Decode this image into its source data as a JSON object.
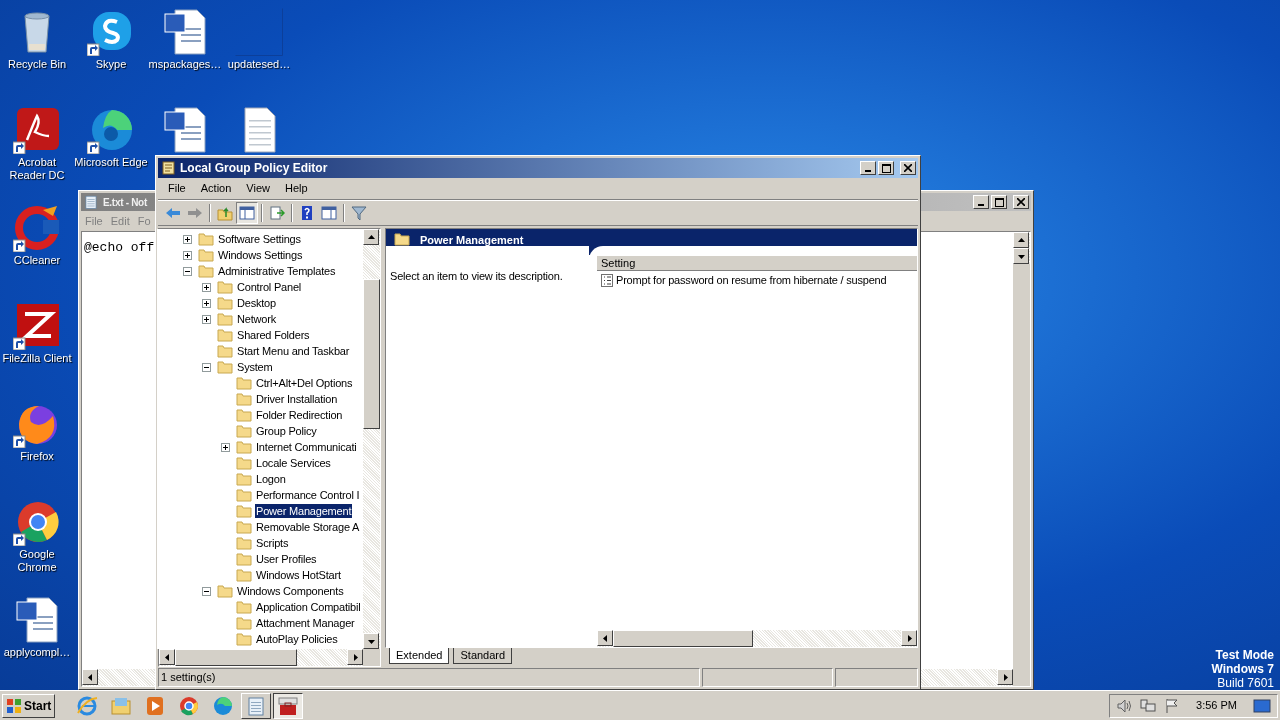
{
  "desktop_icons": [
    {
      "label": "Recycle Bin",
      "kind": "recycle-bin",
      "shortcut": false
    },
    {
      "label": "Skype",
      "kind": "skype",
      "shortcut": true
    },
    {
      "label": "mspackages…",
      "kind": "word",
      "shortcut": false
    },
    {
      "label": "updatesed…",
      "kind": "blank",
      "shortcut": false
    },
    {
      "label": "Acrobat Reader DC",
      "kind": "acrobat",
      "shortcut": true
    },
    {
      "label": "Microsoft Edge",
      "kind": "edge",
      "shortcut": true
    },
    {
      "kind": "word",
      "shortcut": false
    },
    {
      "kind": "text",
      "shortcut": false
    },
    {
      "label": "CCleaner",
      "kind": "ccleaner",
      "shortcut": true
    },
    {
      "label": "FileZilla Client",
      "kind": "filezilla",
      "shortcut": true
    },
    {
      "label": "Firefox",
      "kind": "firefox",
      "shortcut": true
    },
    {
      "label": "Google Chrome",
      "kind": "chrome",
      "shortcut": true
    },
    {
      "label": "applycompl…",
      "kind": "word",
      "shortcut": false
    }
  ],
  "os_notice": [
    "Test Mode",
    "Windows 7",
    "Build 7601"
  ],
  "notepad_window": {
    "title": "E.txt - Not",
    "menu": [
      "File",
      "Edit",
      "Fo"
    ],
    "content": "@echo off"
  },
  "gpe_window": {
    "title": "Local Group Policy Editor",
    "menu": [
      "File",
      "Action",
      "View",
      "Help"
    ],
    "tree": [
      {
        "label": "Software Settings",
        "expanded": false,
        "selected": false
      },
      {
        "label": "Windows Settings",
        "expanded": false,
        "selected": false
      },
      {
        "label": "Administrative Templates",
        "expanded": true,
        "selected": false,
        "children": [
          {
            "label": "Control Panel",
            "expanded": false,
            "selected": false
          },
          {
            "label": "Desktop",
            "expanded": false,
            "selected": false
          },
          {
            "label": "Network",
            "expanded": false,
            "selected": false
          },
          {
            "label": "Shared Folders",
            "selected": false
          },
          {
            "label": "Start Menu and Taskbar",
            "selected": false
          },
          {
            "label": "System",
            "expanded": true,
            "selected": false,
            "children": [
              {
                "label": "Ctrl+Alt+Del Options",
                "selected": false
              },
              {
                "label": "Driver Installation",
                "selected": false
              },
              {
                "label": "Folder Redirection",
                "selected": false
              },
              {
                "label": "Group Policy",
                "selected": false
              },
              {
                "label": "Internet Communicati",
                "expanded": false,
                "selected": false
              },
              {
                "label": "Locale Services",
                "selected": false
              },
              {
                "label": "Logon",
                "selected": false
              },
              {
                "label": "Performance Control I",
                "selected": false
              },
              {
                "label": "Power Management",
                "selected": true
              },
              {
                "label": "Removable Storage A",
                "selected": false
              },
              {
                "label": "Scripts",
                "selected": false
              },
              {
                "label": "User Profiles",
                "selected": false
              },
              {
                "label": "Windows HotStart",
                "selected": false
              }
            ]
          },
          {
            "label": "Windows Components",
            "expanded": true,
            "selected": false,
            "children": [
              {
                "label": "Application Compatibil",
                "selected": false
              },
              {
                "label": "Attachment Manager",
                "selected": false
              },
              {
                "label": "AutoPlay Policies",
                "selected": false
              }
            ]
          }
        ]
      }
    ],
    "details": {
      "header": "Power Management",
      "description": "Select an item to view its description.",
      "column": "Setting",
      "rows": [
        "Prompt for password on resume from hibernate / suspend"
      ]
    },
    "tabs": [
      {
        "label": "Extended",
        "selected": true
      },
      {
        "label": "Standard",
        "selected": false
      }
    ],
    "status": "1 setting(s)"
  },
  "taskbar": {
    "start": "Start",
    "buttons": [
      {
        "kind": "ie",
        "active": false
      },
      {
        "kind": "explorer",
        "active": false
      },
      {
        "kind": "media",
        "active": false
      },
      {
        "kind": "chrome",
        "active": false
      },
      {
        "kind": "edge",
        "active": false
      },
      {
        "kind": "notepad",
        "active": false,
        "window": true
      },
      {
        "kind": "gpe",
        "active": true,
        "window": true
      }
    ],
    "clock": "3:56 PM"
  }
}
